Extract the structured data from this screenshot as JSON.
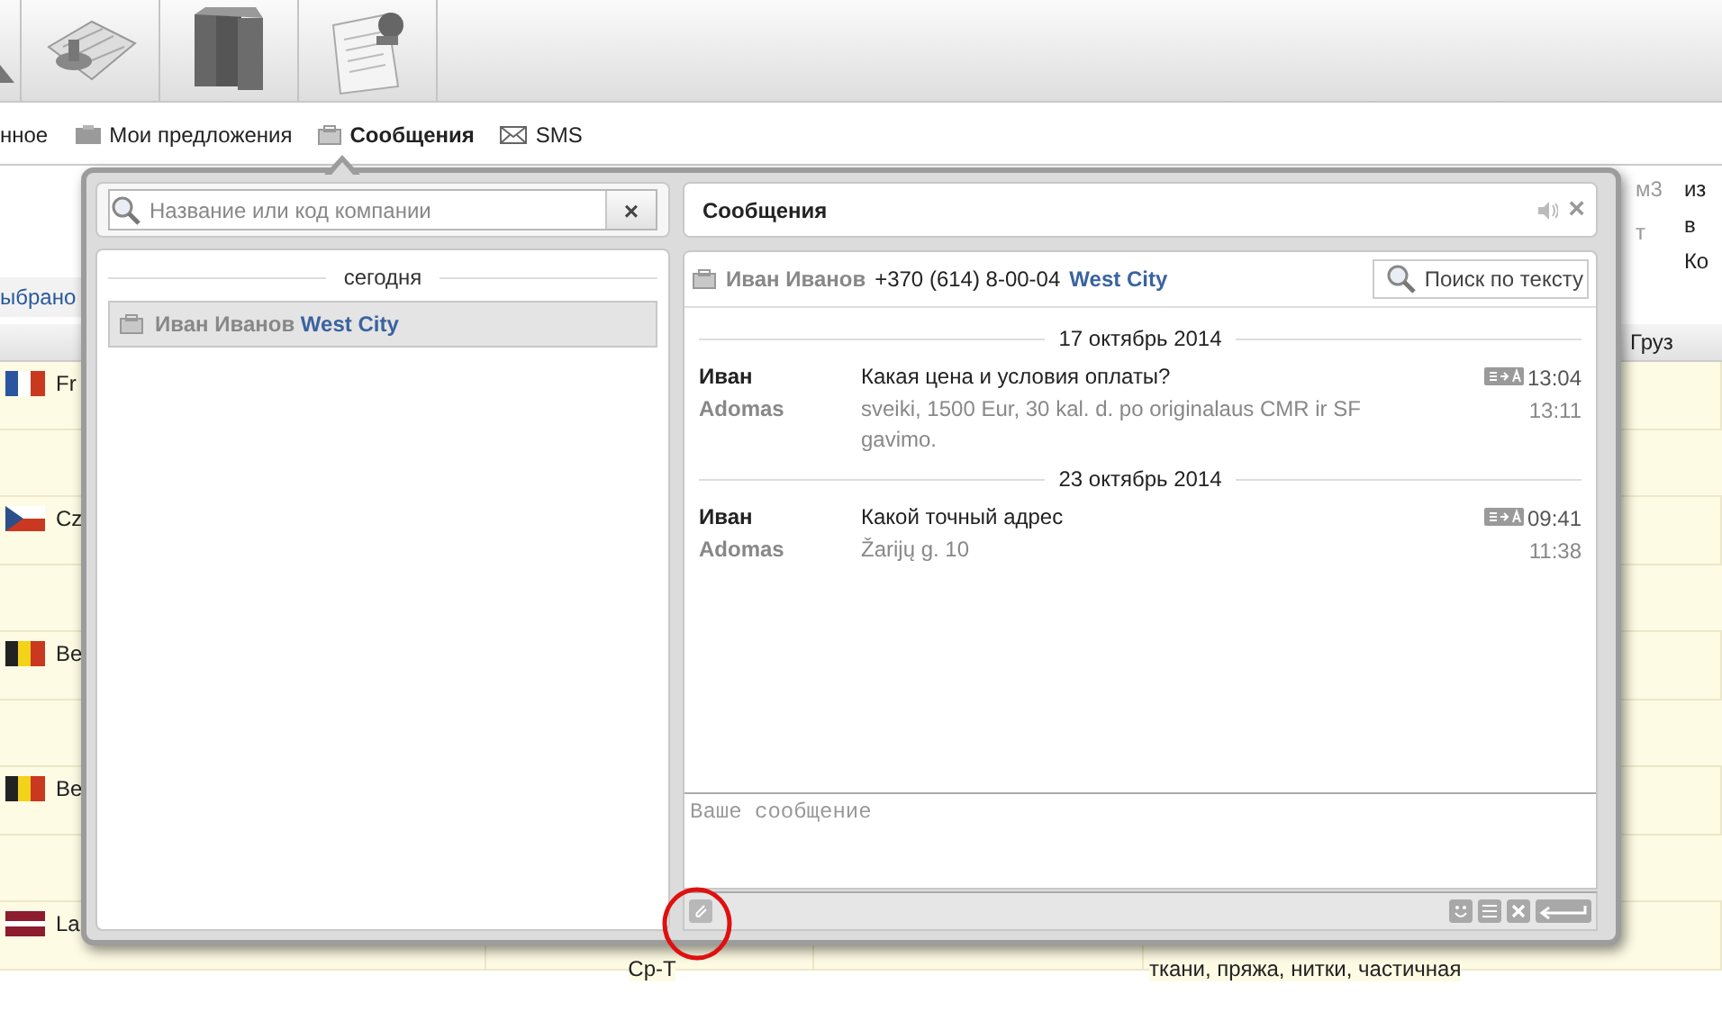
{
  "nav_tabs": [
    {
      "label": "нное",
      "kind": "text",
      "selected": false
    },
    {
      "label": "Мои предложения",
      "kind": "folder",
      "selected": false
    },
    {
      "label": "Сообщения",
      "kind": "messages",
      "selected": true
    },
    {
      "label": "SMS",
      "kind": "sms",
      "selected": false
    }
  ],
  "filter_link": "ыбрано",
  "form_fragment": {
    "units": [
      "м3",
      "т"
    ],
    "labels": [
      "из",
      "в",
      "Ко"
    ]
  },
  "table": {
    "header": "Груз",
    "rows": [
      {
        "kind": "fr",
        "label": "Fr"
      },
      {
        "kind": "cz",
        "label": "Cz"
      },
      {
        "kind": "be",
        "label": "Be"
      },
      {
        "kind": "be",
        "label": "Be"
      },
      {
        "kind": "lv",
        "label": "La",
        "column_2": "Ср-Т",
        "column_4": "ткани, пряжа, нитки, частичная"
      }
    ]
  },
  "dialog": {
    "search": {
      "placeholder": "Название или код компании",
      "clear": "×"
    },
    "contacts_group": "сегодня",
    "contacts": [
      {
        "name": "Иван Иванов",
        "company": "West City",
        "selected": true
      }
    ],
    "title": "Сообщения",
    "close": "×",
    "contact": {
      "name": "Иван Иванов",
      "phone": "+370 (614) 8-00-04",
      "company": "West City"
    },
    "search_text_button": "Поиск по тексту",
    "days": [
      {
        "date": "17 октябрь 2014",
        "messages": [
          {
            "sender": "Иван",
            "kind": "own",
            "text": "Какая цена и условия оплаты?",
            "time": "13:04",
            "translated": true
          },
          {
            "sender": "Adomas",
            "kind": "other",
            "text": "sveiki, 1500 Eur, 30 kal. d. po originalaus CMR ir SF gavimo.",
            "time": "13:11",
            "translated": false
          }
        ]
      },
      {
        "date": "23 октябрь 2014",
        "messages": [
          {
            "sender": "Иван",
            "kind": "own",
            "text": "Какой точный адрес",
            "time": "09:41",
            "translated": true
          },
          {
            "sender": "Adomas",
            "kind": "other",
            "text": "Žarijų g. 10",
            "time": "11:38",
            "translated": false
          }
        ]
      }
    ],
    "composer": {
      "placeholder": "Ваше сообщение"
    }
  }
}
